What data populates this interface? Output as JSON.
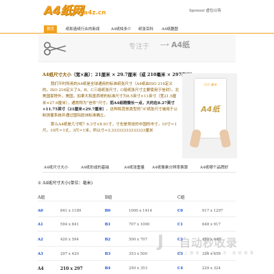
{
  "header": {
    "logo_main": "A4纸网",
    "logo_sub": "a4z.cn",
    "sponsor": "Sponsor 虚位以待"
  },
  "nav": {
    "items": [
      {
        "label": "首页",
        "active": true
      },
      {
        "label": "纸和造纸行业的新闻"
      },
      {
        "label": "A4纸知多少"
      },
      {
        "label": "纸张百科"
      },
      {
        "label": "A4纸趣图"
      }
    ]
  },
  "banner": {
    "slogan": "专注于",
    "brand": "A4纸"
  },
  "article": {
    "title_prefix": "A4纸尺寸大小",
    "title_rest": "（宽×高）：21厘米 × 29.7厘米（或 210毫米 × 297毫米）",
    "p1": "我们平时所用的A4纸是全球通用的标准纸张尺寸（A4纸由ISO 216定义的。ISO 216定义了A、B、C三组纸张尺寸，C组纸张尺寸主要使用于信封）。北美国家除外，美国，加拿大和墨西哥的标准尺寸为8.5英寸×11英寸（宽21.5厘米×27.9厘米），通常称为“信件”尺寸。",
    "p1_bold": "而A4纸稍微长一点，大约在8.27英寸×11.75英寸（21厘米×29.7厘米）",
    "p1_tail": "。这种和其他类型的“A”纸张尺寸被用于公制测量系统并通过国际欧洲标准确立。",
    "p2": "那么A4纸是几寸呢？6.3寸×8.91寸，寸也是常说的中国的市寸，10寸＝1尺，10尺＝1丈，3尺＝1米，所以寸≈3.33333333333333厘米",
    "image_dim": "210 毫米",
    "image_label": "A4纸"
  },
  "tabs": [
    "A4纸尺寸大小",
    "A4纸形成的基础",
    "A4纸张重量",
    "A4纸像素分辨率换算",
    "A4纸哪个品牌好"
  ],
  "section": {
    "title": "① A4纸尺寸大小(单位：毫米)",
    "col_a": "A组",
    "col_b": "B组",
    "col_c": "C组"
  },
  "size_table": [
    {
      "a": "A0",
      "a_val": "841 x 1189",
      "b": "B0",
      "b_val": "1000 x 1414",
      "c": "C0",
      "c_val": "917 x 1297"
    },
    {
      "a": "A1",
      "a_val": "594 x 841",
      "b": "B1",
      "b_val": "707 x 1000",
      "c": "C1",
      "c_val": "648 x 917"
    },
    {
      "a": "A2",
      "a_val": "420 x 594",
      "b": "B2",
      "b_val": "500 x 707",
      "c": "C2",
      "c_val": "458 x 648"
    },
    {
      "a": "A3",
      "a_val": "297 x 420",
      "b": "B3",
      "b_val": "353 x 500",
      "c": "C3",
      "c_val": "324 x 458"
    },
    {
      "a": "A4",
      "a_val": "210 x 297",
      "b": "B4",
      "b_val": "250 x 353",
      "c": "C4",
      "c_val": "229 x 324"
    }
  ],
  "watermark": {
    "mark": "J",
    "text": "自动秒收录",
    "sub": "做 上 排 名 · 来 访 一 次 · 自 动 收 录"
  },
  "colors": {
    "accent": "#f0a020",
    "link": "#1a4fd6",
    "body_text": "#8a5a00"
  }
}
